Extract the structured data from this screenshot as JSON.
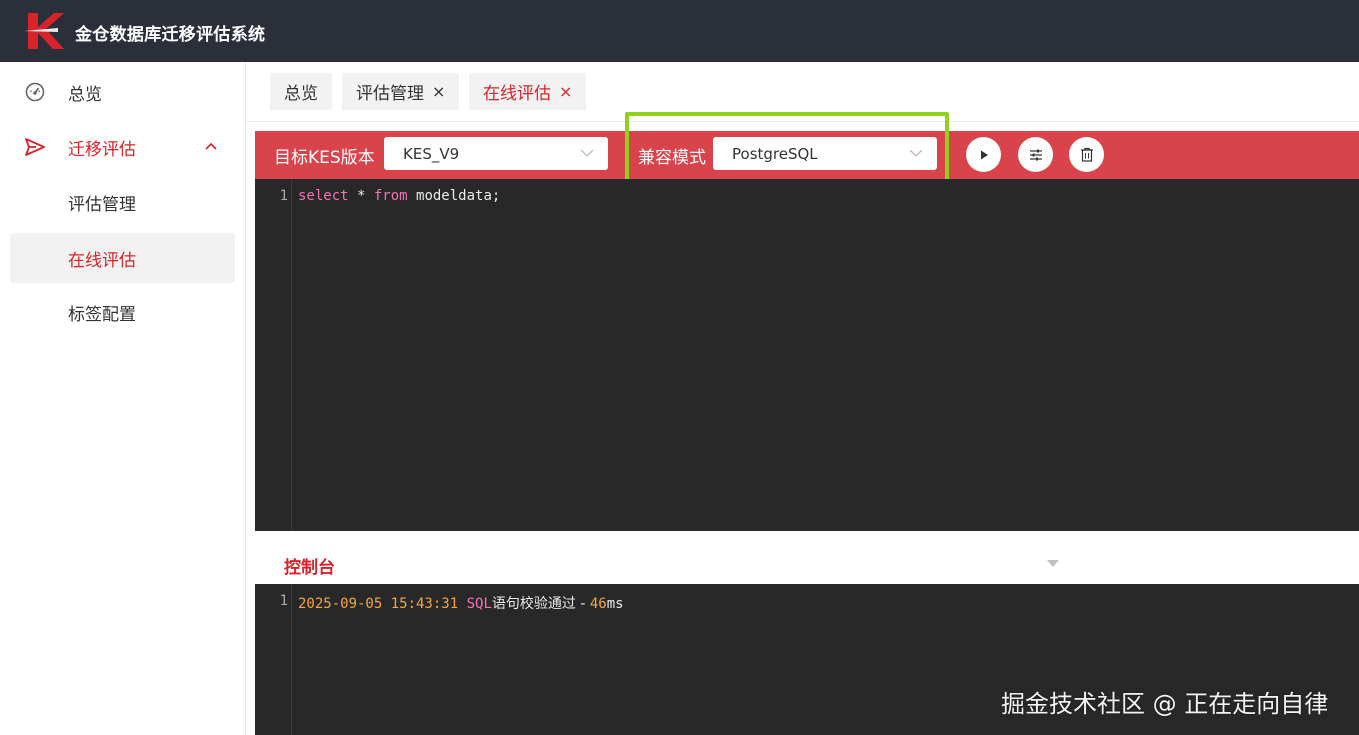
{
  "app": {
    "title": "金仓数据库迁移评估系统"
  },
  "sidebar": {
    "overview": "总览",
    "migration": "迁移评估",
    "sub_items": [
      "评估管理",
      "在线评估",
      "标签配置"
    ]
  },
  "tabs": [
    {
      "label": "总览"
    },
    {
      "label": "评估管理",
      "close": "×"
    },
    {
      "label": "在线评估",
      "close": "×"
    }
  ],
  "toolbar": {
    "target_label": "目标KES版本",
    "target_value": "KES_V9",
    "compat_label": "兼容模式",
    "compat_value": "PostgreSQL"
  },
  "editor": {
    "line_number": "1",
    "kw_select": "select",
    "star": " * ",
    "kw_from": "from",
    "rest": " modeldata;"
  },
  "console": {
    "title": "控制台",
    "line_number": "1",
    "timestamp": "2025-09-05 15:43:31",
    "sql": "SQL",
    "message": "语句校验通过 - ",
    "duration": "46",
    "unit": "ms"
  },
  "watermark": "掘金技术社区 @ 正在走向自律",
  "colors": {
    "header_bg": "#2b2f3a",
    "accent_red": "#d8232a",
    "toolbar_red": "#d9434b",
    "highlight_green": "#8fd11c",
    "editor_bg": "#282828"
  }
}
